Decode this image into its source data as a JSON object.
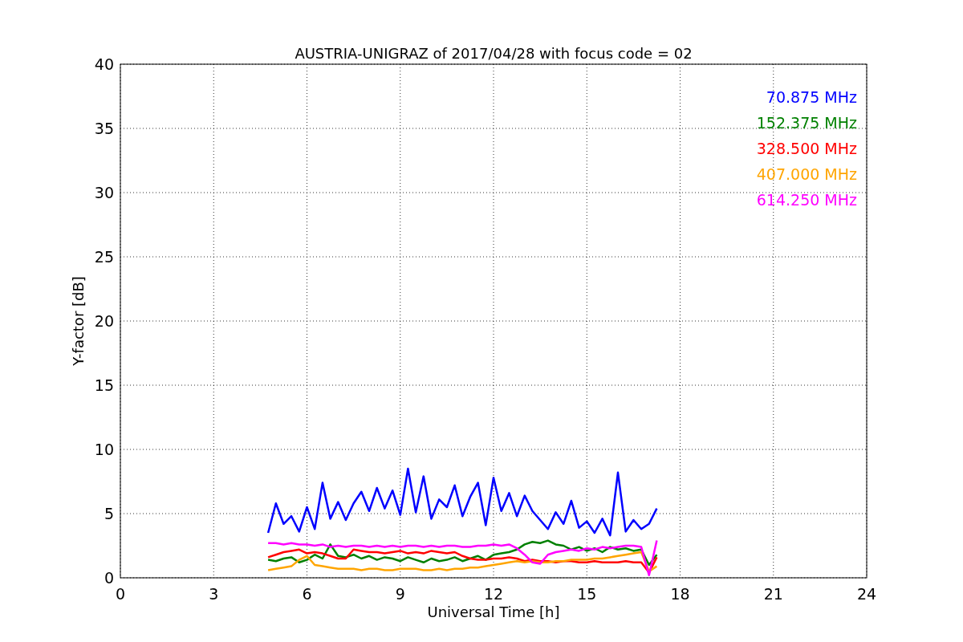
{
  "chart_data": {
    "type": "line",
    "title": "AUSTRIA-UNIGRAZ of 2017/04/28 with focus code = 02",
    "xlabel": "Universal Time [h]",
    "ylabel": "Y-factor [dB]",
    "xlim": [
      0,
      24
    ],
    "ylim": [
      0,
      40
    ],
    "xticks": [
      0,
      3,
      6,
      9,
      12,
      15,
      18,
      21,
      24
    ],
    "yticks": [
      0,
      5,
      10,
      15,
      20,
      25,
      30,
      35,
      40
    ],
    "grid": true,
    "x": [
      4.75,
      5.0,
      5.25,
      5.5,
      5.75,
      6.0,
      6.25,
      6.5,
      6.75,
      7.0,
      7.25,
      7.5,
      7.75,
      8.0,
      8.25,
      8.5,
      8.75,
      9.0,
      9.25,
      9.5,
      9.75,
      10.0,
      10.25,
      10.5,
      10.75,
      11.0,
      11.25,
      11.5,
      11.75,
      12.0,
      12.25,
      12.5,
      12.75,
      13.0,
      13.25,
      13.5,
      13.75,
      14.0,
      14.25,
      14.5,
      14.75,
      15.0,
      15.25,
      15.5,
      15.75,
      16.0,
      16.25,
      16.5,
      16.75,
      17.0,
      17.25
    ],
    "series": [
      {
        "name": "70.875 MHz",
        "color": "#0000ff",
        "values": [
          3.5,
          5.8,
          4.2,
          4.8,
          3.6,
          5.5,
          3.8,
          7.4,
          4.6,
          5.9,
          4.5,
          5.8,
          6.7,
          5.2,
          7.0,
          5.4,
          6.8,
          4.9,
          8.5,
          5.1,
          7.9,
          4.6,
          6.1,
          5.5,
          7.2,
          4.8,
          6.3,
          7.4,
          4.1,
          7.8,
          5.2,
          6.6,
          4.8,
          6.4,
          5.2,
          4.5,
          3.8,
          5.1,
          4.2,
          6.0,
          3.9,
          4.4,
          3.5,
          4.6,
          3.3,
          8.2,
          3.6,
          4.5,
          3.8,
          4.2,
          5.4
        ]
      },
      {
        "name": "152.375 MHz",
        "color": "#008000",
        "values": [
          1.4,
          1.3,
          1.5,
          1.6,
          1.2,
          1.4,
          1.8,
          1.5,
          2.6,
          1.7,
          1.6,
          1.8,
          1.5,
          1.7,
          1.4,
          1.6,
          1.5,
          1.3,
          1.6,
          1.4,
          1.2,
          1.5,
          1.3,
          1.4,
          1.6,
          1.3,
          1.5,
          1.7,
          1.4,
          1.8,
          1.9,
          2.0,
          2.2,
          2.6,
          2.8,
          2.7,
          2.9,
          2.6,
          2.5,
          2.2,
          2.4,
          2.1,
          2.3,
          2.0,
          2.4,
          2.2,
          2.3,
          2.1,
          2.2,
          1.0,
          1.8
        ]
      },
      {
        "name": "328.500 MHz",
        "color": "#ff0000",
        "values": [
          1.6,
          1.8,
          2.0,
          2.1,
          2.2,
          1.9,
          2.0,
          1.9,
          1.7,
          1.5,
          1.5,
          2.2,
          2.1,
          2.0,
          2.0,
          1.9,
          2.0,
          2.1,
          1.9,
          2.0,
          1.9,
          2.1,
          2.0,
          1.9,
          2.0,
          1.7,
          1.5,
          1.4,
          1.4,
          1.5,
          1.5,
          1.6,
          1.5,
          1.3,
          1.4,
          1.3,
          1.3,
          1.2,
          1.3,
          1.3,
          1.2,
          1.2,
          1.3,
          1.2,
          1.2,
          1.2,
          1.3,
          1.2,
          1.2,
          0.4,
          1.6
        ]
      },
      {
        "name": "407.000 MHz",
        "color": "#ffa500",
        "values": [
          0.6,
          0.7,
          0.8,
          0.9,
          1.4,
          1.7,
          1.0,
          0.9,
          0.8,
          0.7,
          0.7,
          0.7,
          0.6,
          0.7,
          0.7,
          0.6,
          0.6,
          0.7,
          0.7,
          0.7,
          0.6,
          0.6,
          0.7,
          0.6,
          0.7,
          0.7,
          0.8,
          0.8,
          0.9,
          1.0,
          1.1,
          1.2,
          1.3,
          1.2,
          1.3,
          1.2,
          1.2,
          1.3,
          1.3,
          1.4,
          1.4,
          1.4,
          1.5,
          1.5,
          1.6,
          1.7,
          1.8,
          1.9,
          2.0,
          0.5,
          0.9
        ]
      },
      {
        "name": "614.250 MHz",
        "color": "#ff00ff",
        "values": [
          2.7,
          2.7,
          2.6,
          2.7,
          2.6,
          2.6,
          2.5,
          2.6,
          2.4,
          2.5,
          2.4,
          2.5,
          2.5,
          2.4,
          2.5,
          2.4,
          2.5,
          2.4,
          2.5,
          2.5,
          2.4,
          2.5,
          2.4,
          2.5,
          2.5,
          2.4,
          2.4,
          2.5,
          2.5,
          2.6,
          2.5,
          2.6,
          2.3,
          1.8,
          1.2,
          1.1,
          1.8,
          2.0,
          2.1,
          2.2,
          2.1,
          2.3,
          2.2,
          2.4,
          2.3,
          2.4,
          2.5,
          2.5,
          2.4,
          0.2,
          2.9
        ]
      }
    ]
  }
}
